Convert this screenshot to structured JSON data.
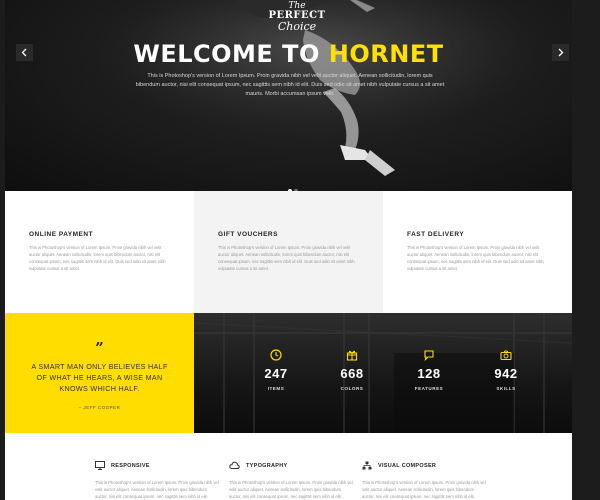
{
  "hero": {
    "logo_line1": "The",
    "logo_line2": "PERFECT",
    "logo_line3": "Choice",
    "title_main": "WELCOME TO ",
    "title_accent": "HORNET",
    "text": "This is Photoshop's version of Lorem Ipsum. Proin gravida nibh vel velit auctor aliquet. Aenean sollicitudin, lorem quis bibendum auctor, nisi elit consequat ipsum, nec sagittis sem nibh id elit. Duis sed odio sit amet nibh vulputate cursus a sit amet mauris. Morbi accumsan ipsum velit.",
    "prev_icon": "chevron-left",
    "next_icon": "chevron-right",
    "slide_count": 2,
    "active_slide": 1
  },
  "features": [
    {
      "title": "ONLINE PAYMENT",
      "text": "This is Photoshop's version of Lorem Ipsum. Proin gravida nibh vel velit auctor aliquet. Aenean sollicitudin, lorem quis bibendum auctor, nisi elit consequat ipsum, nec sagittis sem nibh id elit. Duis sed odio sit amet nibh vulputate cursus a sit amet."
    },
    {
      "title": "GIFT VOUCHERS",
      "text": "This is Photoshop's version of Lorem Ipsum. Proin gravida nibh vel velit auctor aliquet. Aenean sollicitudin, lorem quis bibendum auctor, nisi elit consequat ipsum, nec sagittis sem nibh id elit. Duis sed odio sit amet nibh vulputate cursus a sit amet."
    },
    {
      "title": "FAST DELIVERY",
      "text": "This is Photoshop's version of Lorem Ipsum. Proin gravida nibh vel velit auctor aliquet. Aenean sollicitudin, lorem quis bibendum auctor, nisi elit consequat ipsum, nec sagittis sem nibh id elit. Duis sed odio sit amet nibh vulputate cursus a sit amet."
    }
  ],
  "quote": {
    "mark": "”",
    "text": "A SMART MAN ONLY BELIEVES HALF OF WHAT HE HEARS, A WISE MAN KNOWS WHICH HALF.",
    "author": "– JEFF COOPER"
  },
  "stats": [
    {
      "icon": "clock-icon",
      "number": "247",
      "label": "ITEMS"
    },
    {
      "icon": "gift-icon",
      "number": "668",
      "label": "COLORS"
    },
    {
      "icon": "chat-icon",
      "number": "128",
      "label": "FEATURES"
    },
    {
      "icon": "camera-icon",
      "number": "942",
      "label": "SKILLS"
    }
  ],
  "services": [
    {
      "icon": "monitor-icon",
      "title": "RESPONSIVE",
      "text": "This is Photoshop's version of Lorem Ipsum. Proin gravida nibh vel velit auctor aliquet. Aenean sollicitudin, lorem quis bibendum auctor, nisi elit consequat ipsum, nec sagittis sem nibh id elit."
    },
    {
      "icon": "cloud-icon",
      "title": "TYPOGRAPHY",
      "text": "This is Photoshop's version of Lorem Ipsum. Proin gravida nibh vel velit auctor aliquet. Aenean sollicitudin, lorem quis bibendum auctor, nisi elit consequat ipsum, nec sagittis sem nibh id elit."
    },
    {
      "icon": "sitemap-icon",
      "title": "VISUAL COMPOSER",
      "text": "This is Photoshop's version of Lorem Ipsum. Proin gravida nibh vel velit auctor aliquet. Aenean sollicitudin, lorem quis bibendum auctor, nisi elit consequat ipsum, nec sagittis sem nibh id elit."
    }
  ],
  "colors": {
    "accent": "#ffdd00",
    "title_accent": "#ffe000",
    "dark": "#1c1c1c"
  }
}
